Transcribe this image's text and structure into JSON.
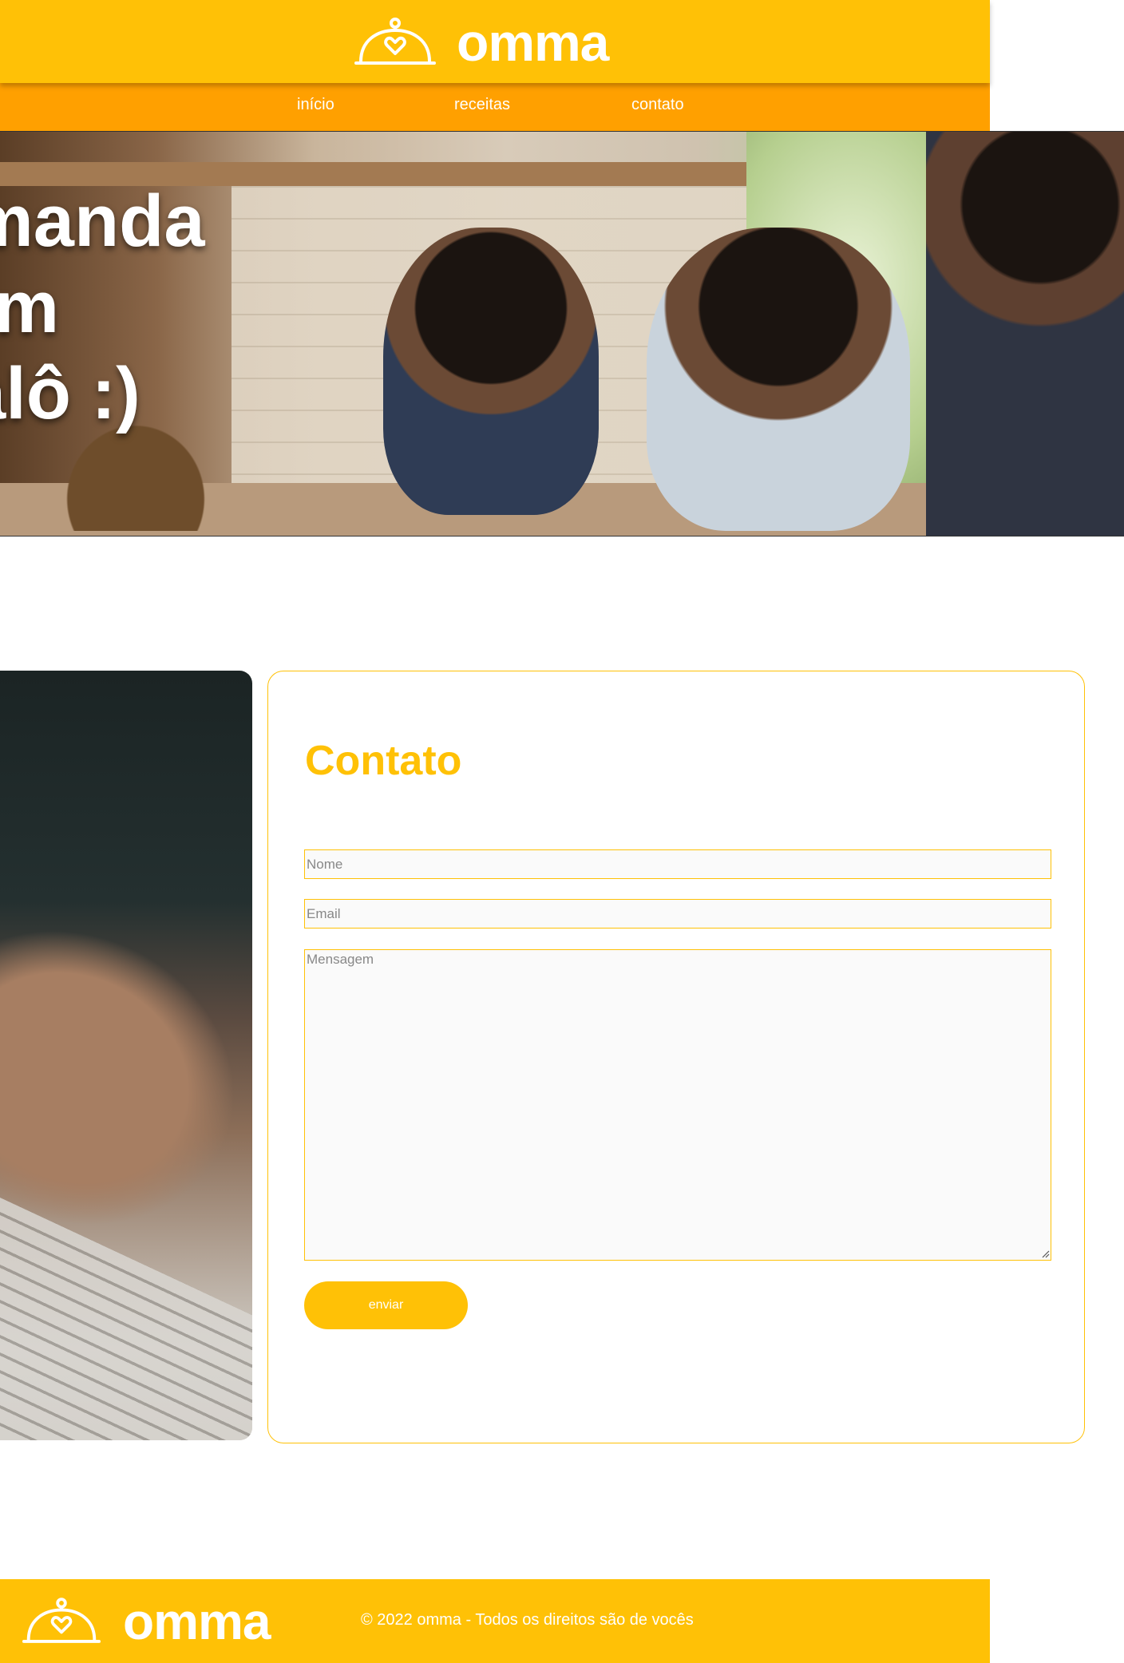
{
  "brand": {
    "name": "omma",
    "logo_icon": "cloche-heart-icon"
  },
  "nav": {
    "items": [
      {
        "label": "início"
      },
      {
        "label": "receitas"
      },
      {
        "label": "contato"
      }
    ]
  },
  "hero": {
    "lines": [
      "manda",
      "um",
      "alô :)"
    ]
  },
  "contact": {
    "title": "Contato",
    "name_placeholder": "Nome",
    "email_placeholder": "Email",
    "message_placeholder": "Mensagem",
    "submit_label": "enviar"
  },
  "footer": {
    "copyright": "© 2022 omma - Todos os direitos são de vocês"
  },
  "colors": {
    "primary": "#FFC106",
    "nav": "#FFA000",
    "text_on_primary": "#FFFFFF"
  }
}
